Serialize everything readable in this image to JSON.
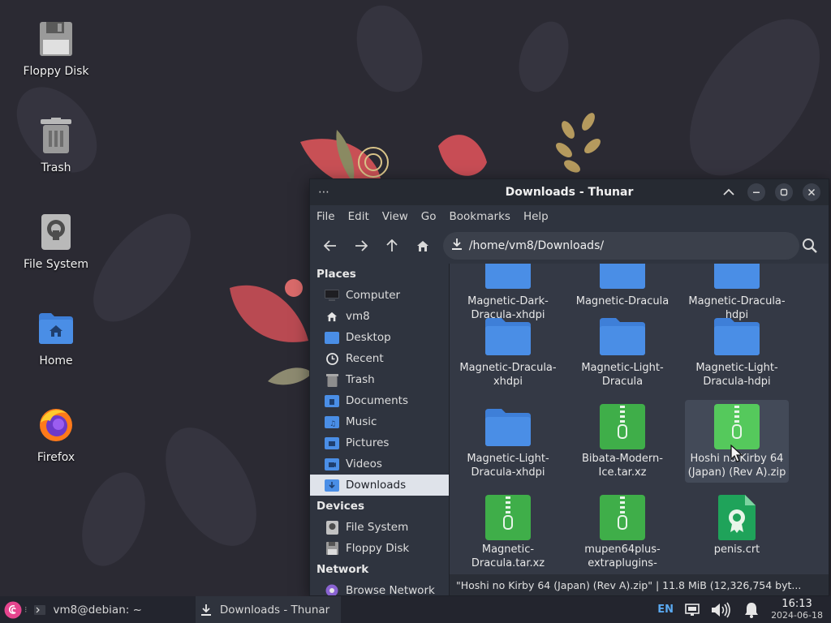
{
  "desktop": {
    "icons": [
      {
        "label": "Floppy Disk",
        "icon": "floppy-disk-icon"
      },
      {
        "label": "Trash",
        "icon": "trash-icon"
      },
      {
        "label": "File System",
        "icon": "harddisk-icon"
      },
      {
        "label": "Home",
        "icon": "home-folder-icon"
      },
      {
        "label": "Firefox",
        "icon": "firefox-icon"
      }
    ]
  },
  "window": {
    "title": "Downloads - Thunar",
    "menu": [
      "File",
      "Edit",
      "View",
      "Go",
      "Bookmarks",
      "Help"
    ],
    "location": "/home/vm8/Downloads/"
  },
  "sidebar": {
    "sections": [
      {
        "heading": "Places",
        "items": [
          {
            "label": "Computer",
            "icon": "computer-icon"
          },
          {
            "label": "vm8",
            "icon": "home-icon"
          },
          {
            "label": "Desktop",
            "icon": "desktop-folder-icon"
          },
          {
            "label": "Recent",
            "icon": "clock-icon"
          },
          {
            "label": "Trash",
            "icon": "trash-icon"
          },
          {
            "label": "Documents",
            "icon": "documents-folder-icon"
          },
          {
            "label": "Music",
            "icon": "music-folder-icon"
          },
          {
            "label": "Pictures",
            "icon": "pictures-folder-icon"
          },
          {
            "label": "Videos",
            "icon": "videos-folder-icon"
          },
          {
            "label": "Downloads",
            "icon": "downloads-folder-icon"
          }
        ]
      },
      {
        "heading": "Devices",
        "items": [
          {
            "label": "File System",
            "icon": "harddisk-icon"
          },
          {
            "label": "Floppy Disk",
            "icon": "floppy-icon"
          }
        ]
      },
      {
        "heading": "Network",
        "items": [
          {
            "label": "Browse Network",
            "icon": "network-icon"
          }
        ]
      }
    ],
    "selected": "Downloads"
  },
  "files": [
    {
      "name": "Magnetic-Dark-\nDracula-xhdpi",
      "type": "folder"
    },
    {
      "name": "Magnetic-Dracula",
      "type": "folder"
    },
    {
      "name": "Magnetic-Dracula-\nhdpi",
      "type": "folder"
    },
    {
      "name": "Magnetic-Dracula-\nxhdpi",
      "type": "folder"
    },
    {
      "name": "Magnetic-Light-\nDracula",
      "type": "folder"
    },
    {
      "name": "Magnetic-Light-\nDracula-hdpi",
      "type": "folder"
    },
    {
      "name": "Magnetic-Light-\nDracula-xhdpi",
      "type": "folder"
    },
    {
      "name": "Bibata-Modern-\nIce.tar.xz",
      "type": "archive"
    },
    {
      "name": "Hoshi no Kirby 64\n(Japan) (Rev A).zip",
      "type": "archive",
      "selected": true
    },
    {
      "name": "Magnetic-\nDracula.tar.xz",
      "type": "archive"
    },
    {
      "name": "mupen64plus-\nextraplugins-",
      "type": "archive"
    },
    {
      "name": "penis.crt",
      "type": "certificate"
    }
  ],
  "status": "\"Hoshi no Kirby 64 (Japan) (Rev A).zip\"  |  11.8 MiB (12,326,754 byt...",
  "taskbar": {
    "tasks": [
      {
        "label": "vm8@debian: ~",
        "icon": "terminal-icon"
      },
      {
        "label": "Downloads - Thunar",
        "icon": "download-icon",
        "active": true
      }
    ],
    "keyboard": "EN",
    "time": "16:13",
    "date": "2024-06-18"
  },
  "colors": {
    "folder": "#4a8ee6",
    "archive": "#3fae49",
    "certificate": "#1fa35a",
    "accent_selected_row": "#dfe3ea"
  }
}
